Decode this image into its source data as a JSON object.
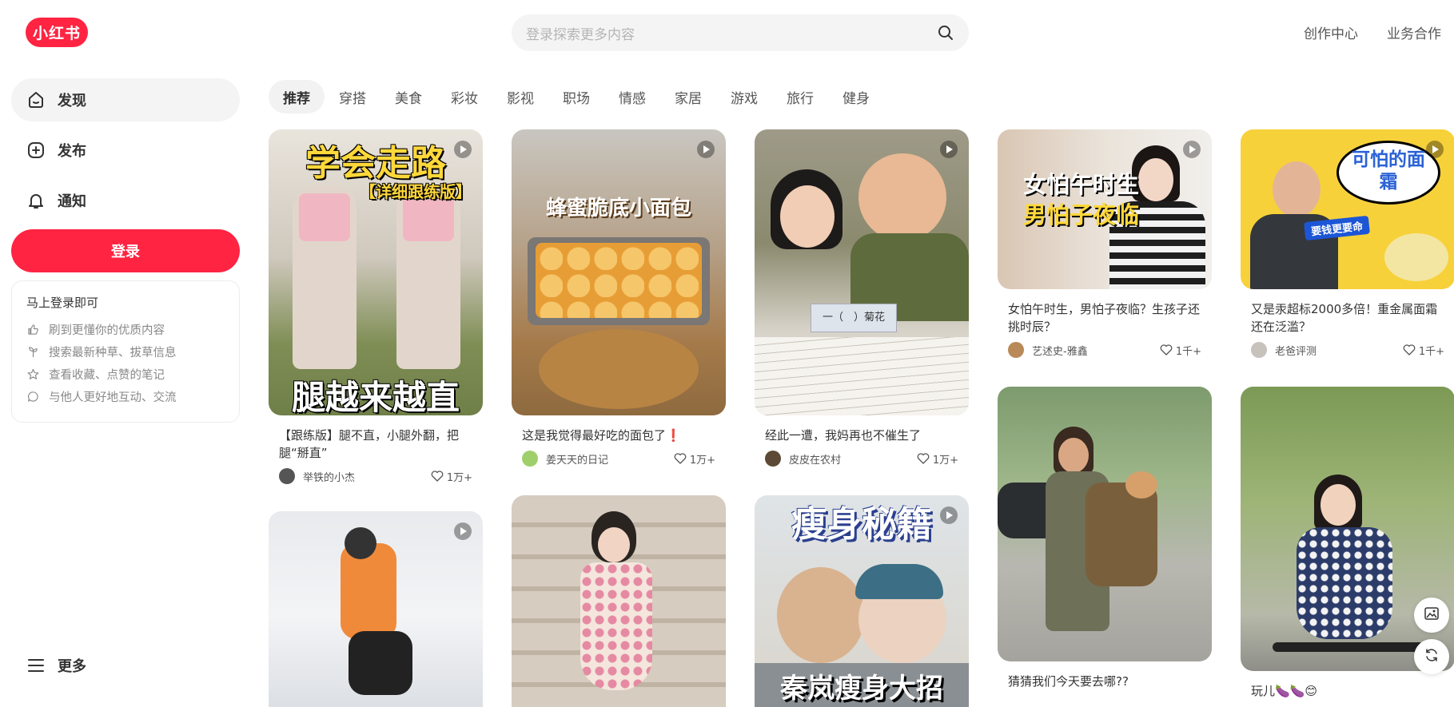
{
  "header": {
    "logo": "小红书",
    "search_placeholder": "登录探索更多内容",
    "links": [
      "创作中心",
      "业务合作"
    ]
  },
  "sidebar": {
    "items": [
      {
        "label": "发现",
        "icon": "home-icon"
      },
      {
        "label": "发布",
        "icon": "plus-square-icon"
      },
      {
        "label": "通知",
        "icon": "bell-icon"
      }
    ],
    "login_button": "登录",
    "login_card": {
      "title": "马上登录即可",
      "perks": [
        {
          "icon": "thumbs-up-icon",
          "text": "刷到更懂你的优质内容"
        },
        {
          "icon": "sprout-icon",
          "text": "搜索最新种草、拔草信息"
        },
        {
          "icon": "star-icon",
          "text": "查看收藏、点赞的笔记"
        },
        {
          "icon": "chat-icon",
          "text": "与他人更好地互动、交流"
        }
      ]
    },
    "more": "更多"
  },
  "tabs": [
    "推荐",
    "穿搭",
    "美食",
    "彩妆",
    "影视",
    "职场",
    "情感",
    "家居",
    "游戏",
    "旅行",
    "健身"
  ],
  "active_tab": "推荐",
  "accent_color": "#ff2442",
  "feed": [
    {
      "cover_text_top": "学会走路",
      "cover_text_sub": "【详细跟练版】",
      "cover_text_bottom": "腿越来越直",
      "title": "【跟练版】腿不直，小腿外翻，把腿“掰直”",
      "author": "举铁的小杰",
      "likes": "1万+",
      "video": true
    },
    {
      "cover_text_top": "蜂蜜脆底小面包",
      "title": "这是我觉得最好吃的面包了❗",
      "author": "姜天天的日记",
      "likes": "1万+",
      "video": true
    },
    {
      "cover_text_top": "一（　）菊花",
      "title": "经此一遭，我妈再也不催生了",
      "author": "皮皮在农村",
      "likes": "1万+",
      "video": true
    },
    {
      "cover_text_top": "女怕午时生",
      "cover_text_bottom": "男怕子夜临",
      "title": "女怕午时生，男怕子夜临？生孩子还挑时辰？",
      "author": "艺述史-雅鑫",
      "likes": "1千+",
      "video": true
    },
    {
      "cover_text_top": "可怕的面霜",
      "cover_text_sub": "要钱更要命",
      "title": "又是汞超标2000多倍！重金属面霜还在泛滥？",
      "author": "老爸评测",
      "likes": "1千+",
      "video": true
    },
    {
      "title": "",
      "author": "",
      "likes": "",
      "video": true
    },
    {
      "title": "",
      "author": "",
      "likes": "",
      "video": false
    },
    {
      "cover_text_top": "瘦身秘籍",
      "cover_text_bottom": "秦岚瘦身大招",
      "title": "",
      "author": "",
      "likes": "",
      "video": true
    },
    {
      "title": "猜猜我们今天要去哪??",
      "author": "",
      "likes": "",
      "video": false
    },
    {
      "title": "玩儿🍆🍆😊",
      "author": "",
      "likes": "",
      "video": false
    }
  ]
}
